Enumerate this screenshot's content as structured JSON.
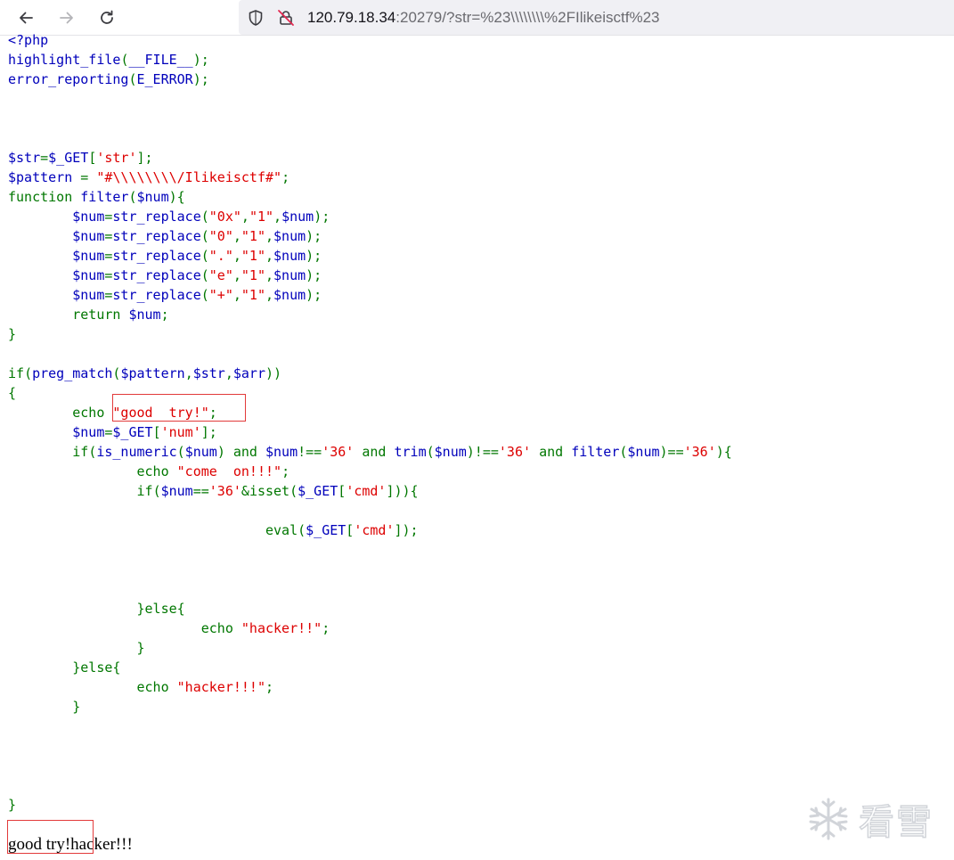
{
  "browser": {
    "url_host": "120.79.18.34",
    "url_rest": ":20279/?str=%23\\\\\\\\\\\\\\\\%2FIlikeisctf%23"
  },
  "source_lines": [
    [
      {
        "t": "<?php",
        "c": "default"
      }
    ],
    [
      {
        "t": "highlight_file",
        "c": "default"
      },
      {
        "t": "(",
        "c": "keyword"
      },
      {
        "t": "__FILE__",
        "c": "default"
      },
      {
        "t": ");",
        "c": "keyword"
      }
    ],
    [
      {
        "t": "error_reporting",
        "c": "default"
      },
      {
        "t": "(",
        "c": "keyword"
      },
      {
        "t": "E_ERROR",
        "c": "default"
      },
      {
        "t": ");",
        "c": "keyword"
      }
    ],
    [],
    [],
    [],
    [
      {
        "t": "$str",
        "c": "default"
      },
      {
        "t": "=",
        "c": "keyword"
      },
      {
        "t": "$_GET",
        "c": "default"
      },
      {
        "t": "[",
        "c": "keyword"
      },
      {
        "t": "'str'",
        "c": "string"
      },
      {
        "t": "];",
        "c": "keyword"
      }
    ],
    [
      {
        "t": "$pattern ",
        "c": "default"
      },
      {
        "t": "= ",
        "c": "keyword"
      },
      {
        "t": "\"#\\\\\\\\\\\\\\\\/Ilikeisctf#\"",
        "c": "string"
      },
      {
        "t": ";",
        "c": "keyword"
      }
    ],
    [
      {
        "t": "function ",
        "c": "keyword"
      },
      {
        "t": "filter",
        "c": "default"
      },
      {
        "t": "(",
        "c": "keyword"
      },
      {
        "t": "$num",
        "c": "default"
      },
      {
        "t": "){",
        "c": "keyword"
      }
    ],
    [
      {
        "t": "        ",
        "c": "default"
      },
      {
        "t": "$num",
        "c": "default"
      },
      {
        "t": "=",
        "c": "keyword"
      },
      {
        "t": "str_replace",
        "c": "default"
      },
      {
        "t": "(",
        "c": "keyword"
      },
      {
        "t": "\"0x\"",
        "c": "string"
      },
      {
        "t": ",",
        "c": "keyword"
      },
      {
        "t": "\"1\"",
        "c": "string"
      },
      {
        "t": ",",
        "c": "keyword"
      },
      {
        "t": "$num",
        "c": "default"
      },
      {
        "t": ");",
        "c": "keyword"
      }
    ],
    [
      {
        "t": "        ",
        "c": "default"
      },
      {
        "t": "$num",
        "c": "default"
      },
      {
        "t": "=",
        "c": "keyword"
      },
      {
        "t": "str_replace",
        "c": "default"
      },
      {
        "t": "(",
        "c": "keyword"
      },
      {
        "t": "\"0\"",
        "c": "string"
      },
      {
        "t": ",",
        "c": "keyword"
      },
      {
        "t": "\"1\"",
        "c": "string"
      },
      {
        "t": ",",
        "c": "keyword"
      },
      {
        "t": "$num",
        "c": "default"
      },
      {
        "t": ");",
        "c": "keyword"
      }
    ],
    [
      {
        "t": "        ",
        "c": "default"
      },
      {
        "t": "$num",
        "c": "default"
      },
      {
        "t": "=",
        "c": "keyword"
      },
      {
        "t": "str_replace",
        "c": "default"
      },
      {
        "t": "(",
        "c": "keyword"
      },
      {
        "t": "\".\"",
        "c": "string"
      },
      {
        "t": ",",
        "c": "keyword"
      },
      {
        "t": "\"1\"",
        "c": "string"
      },
      {
        "t": ",",
        "c": "keyword"
      },
      {
        "t": "$num",
        "c": "default"
      },
      {
        "t": ");",
        "c": "keyword"
      }
    ],
    [
      {
        "t": "        ",
        "c": "default"
      },
      {
        "t": "$num",
        "c": "default"
      },
      {
        "t": "=",
        "c": "keyword"
      },
      {
        "t": "str_replace",
        "c": "default"
      },
      {
        "t": "(",
        "c": "keyword"
      },
      {
        "t": "\"e\"",
        "c": "string"
      },
      {
        "t": ",",
        "c": "keyword"
      },
      {
        "t": "\"1\"",
        "c": "string"
      },
      {
        "t": ",",
        "c": "keyword"
      },
      {
        "t": "$num",
        "c": "default"
      },
      {
        "t": ");",
        "c": "keyword"
      }
    ],
    [
      {
        "t": "        ",
        "c": "default"
      },
      {
        "t": "$num",
        "c": "default"
      },
      {
        "t": "=",
        "c": "keyword"
      },
      {
        "t": "str_replace",
        "c": "default"
      },
      {
        "t": "(",
        "c": "keyword"
      },
      {
        "t": "\"+\"",
        "c": "string"
      },
      {
        "t": ",",
        "c": "keyword"
      },
      {
        "t": "\"1\"",
        "c": "string"
      },
      {
        "t": ",",
        "c": "keyword"
      },
      {
        "t": "$num",
        "c": "default"
      },
      {
        "t": ");",
        "c": "keyword"
      }
    ],
    [
      {
        "t": "        ",
        "c": "default"
      },
      {
        "t": "return ",
        "c": "keyword"
      },
      {
        "t": "$num",
        "c": "default"
      },
      {
        "t": ";",
        "c": "keyword"
      }
    ],
    [
      {
        "t": "}",
        "c": "keyword"
      }
    ],
    [],
    [
      {
        "t": "if",
        "c": "keyword"
      },
      {
        "t": "(",
        "c": "keyword"
      },
      {
        "t": "preg_match",
        "c": "default"
      },
      {
        "t": "(",
        "c": "keyword"
      },
      {
        "t": "$pattern",
        "c": "default"
      },
      {
        "t": ",",
        "c": "keyword"
      },
      {
        "t": "$str",
        "c": "default"
      },
      {
        "t": ",",
        "c": "keyword"
      },
      {
        "t": "$arr",
        "c": "default"
      },
      {
        "t": "))",
        "c": "keyword"
      }
    ],
    [
      {
        "t": "{",
        "c": "keyword"
      }
    ],
    [
      {
        "t": "        ",
        "c": "default"
      },
      {
        "t": "echo ",
        "c": "keyword"
      },
      {
        "t": "\"good  try!\"",
        "c": "string"
      },
      {
        "t": ";",
        "c": "keyword"
      }
    ],
    [
      {
        "t": "        ",
        "c": "default"
      },
      {
        "t": "$num",
        "c": "default"
      },
      {
        "t": "=",
        "c": "keyword"
      },
      {
        "t": "$_GET",
        "c": "default"
      },
      {
        "t": "[",
        "c": "keyword"
      },
      {
        "t": "'num'",
        "c": "string"
      },
      {
        "t": "];",
        "c": "keyword"
      }
    ],
    [
      {
        "t": "        ",
        "c": "default"
      },
      {
        "t": "if",
        "c": "keyword"
      },
      {
        "t": "(",
        "c": "keyword"
      },
      {
        "t": "is_numeric",
        "c": "default"
      },
      {
        "t": "(",
        "c": "keyword"
      },
      {
        "t": "$num",
        "c": "default"
      },
      {
        "t": ") ",
        "c": "keyword"
      },
      {
        "t": "and ",
        "c": "keyword"
      },
      {
        "t": "$num",
        "c": "default"
      },
      {
        "t": "!==",
        "c": "keyword"
      },
      {
        "t": "'36' ",
        "c": "string"
      },
      {
        "t": "and ",
        "c": "keyword"
      },
      {
        "t": "trim",
        "c": "default"
      },
      {
        "t": "(",
        "c": "keyword"
      },
      {
        "t": "$num",
        "c": "default"
      },
      {
        "t": ")!==",
        "c": "keyword"
      },
      {
        "t": "'36' ",
        "c": "string"
      },
      {
        "t": "and ",
        "c": "keyword"
      },
      {
        "t": "filter",
        "c": "default"
      },
      {
        "t": "(",
        "c": "keyword"
      },
      {
        "t": "$num",
        "c": "default"
      },
      {
        "t": ")==",
        "c": "keyword"
      },
      {
        "t": "'36'",
        "c": "string"
      },
      {
        "t": "){",
        "c": "keyword"
      }
    ],
    [
      {
        "t": "                ",
        "c": "default"
      },
      {
        "t": "echo ",
        "c": "keyword"
      },
      {
        "t": "\"come  on!!!\"",
        "c": "string"
      },
      {
        "t": ";",
        "c": "keyword"
      }
    ],
    [
      {
        "t": "                ",
        "c": "default"
      },
      {
        "t": "if",
        "c": "keyword"
      },
      {
        "t": "(",
        "c": "keyword"
      },
      {
        "t": "$num",
        "c": "default"
      },
      {
        "t": "==",
        "c": "keyword"
      },
      {
        "t": "'36'",
        "c": "string"
      },
      {
        "t": "&",
        "c": "keyword"
      },
      {
        "t": "isset",
        "c": "keyword"
      },
      {
        "t": "(",
        "c": "keyword"
      },
      {
        "t": "$_GET",
        "c": "default"
      },
      {
        "t": "[",
        "c": "keyword"
      },
      {
        "t": "'cmd'",
        "c": "string"
      },
      {
        "t": "])){",
        "c": "keyword"
      }
    ],
    [],
    [
      {
        "t": "                                ",
        "c": "default"
      },
      {
        "t": "eval",
        "c": "keyword"
      },
      {
        "t": "(",
        "c": "keyword"
      },
      {
        "t": "$_GET",
        "c": "default"
      },
      {
        "t": "[",
        "c": "keyword"
      },
      {
        "t": "'cmd'",
        "c": "string"
      },
      {
        "t": "]);",
        "c": "keyword"
      }
    ],
    [],
    [],
    [],
    [
      {
        "t": "                ",
        "c": "default"
      },
      {
        "t": "}else{",
        "c": "keyword"
      }
    ],
    [
      {
        "t": "                        ",
        "c": "default"
      },
      {
        "t": "echo ",
        "c": "keyword"
      },
      {
        "t": "\"hacker!!\"",
        "c": "string"
      },
      {
        "t": ";",
        "c": "keyword"
      }
    ],
    [
      {
        "t": "                ",
        "c": "default"
      },
      {
        "t": "}",
        "c": "keyword"
      }
    ],
    [
      {
        "t": "        ",
        "c": "default"
      },
      {
        "t": "}else{",
        "c": "keyword"
      }
    ],
    [
      {
        "t": "                ",
        "c": "default"
      },
      {
        "t": "echo ",
        "c": "keyword"
      },
      {
        "t": "\"hacker!!!\"",
        "c": "string"
      },
      {
        "t": ";",
        "c": "keyword"
      }
    ],
    [
      {
        "t": "        ",
        "c": "default"
      },
      {
        "t": "}",
        "c": "keyword"
      }
    ],
    [],
    [],
    [],
    [],
    [
      {
        "t": "}",
        "c": "keyword"
      }
    ]
  ],
  "output_text": "good try!hacker!!!",
  "watermark": {
    "text": "看雪",
    "icon": "snowflake-icon"
  },
  "colors": {
    "php_default": "#0000bb",
    "php_keyword": "#007700",
    "php_string": "#dd0000",
    "annotation": "#e23a3a"
  },
  "icons": {
    "back": "arrow-left-icon",
    "forward": "arrow-right-icon",
    "reload": "reload-icon",
    "tracking": "shield-icon",
    "insecure": "lock-crossed-icon"
  }
}
